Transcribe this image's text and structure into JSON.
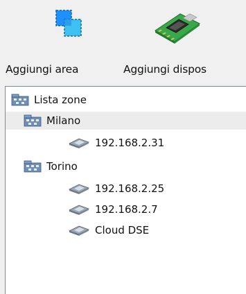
{
  "toolbar": {
    "add_area_label": "Aggiungi area",
    "add_device_label": "Aggiungi dispos"
  },
  "tree": {
    "root": {
      "label": "Lista zone",
      "icon": "network-zone-icon"
    },
    "zones": [
      {
        "label": "Milano",
        "icon": "network-zone-icon",
        "devices": [
          {
            "label": "192.168.2.31",
            "icon": "network-device-icon"
          }
        ]
      },
      {
        "label": "Torino",
        "icon": "network-zone-icon",
        "devices": [
          {
            "label": "192.168.2.25",
            "icon": "network-device-icon"
          },
          {
            "label": "192.168.2.7",
            "icon": "network-device-icon"
          },
          {
            "label": "Cloud DSE",
            "icon": "network-device-icon"
          }
        ]
      }
    ],
    "highlight_color": "#ececec"
  }
}
